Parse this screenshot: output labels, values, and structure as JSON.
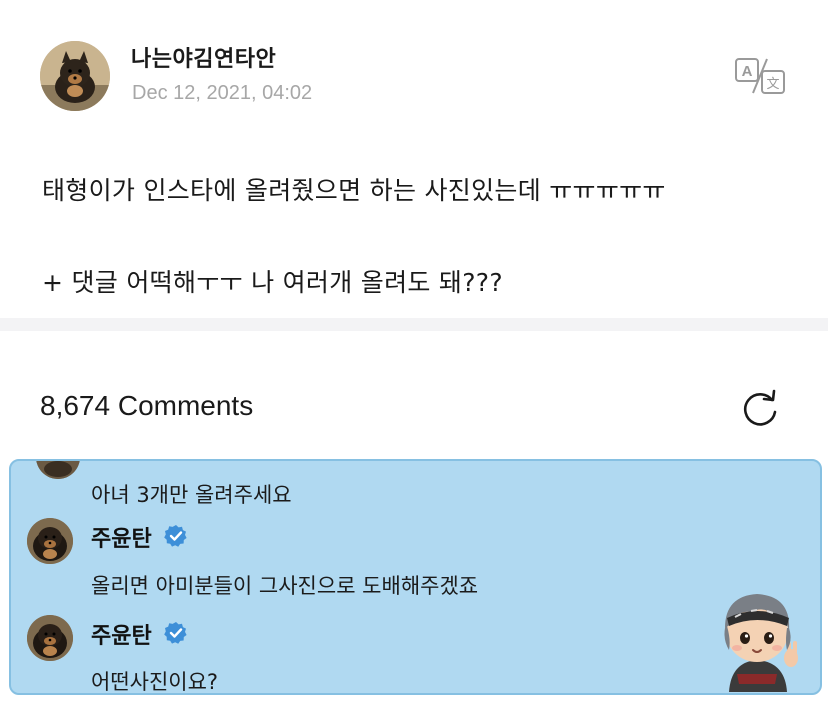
{
  "post": {
    "author_name": "나는야김연타안",
    "timestamp": "Dec 12, 2021, 04:02",
    "line1": "태형이가 인스타에 올려줬으면 하는 사진있는데 ㅠㅠㅠㅠㅠ",
    "line2": "+ 댓글 어떡해ㅜㅜ 나 여러개 올려도 돼???"
  },
  "icons": {
    "author_avatar": "dog-avatar",
    "translate": "translate-icon",
    "refresh": "refresh-icon",
    "verified": "verified-badge-icon"
  },
  "comments_header": {
    "count_label": "8,674 Comments"
  },
  "comments": {
    "partial_text": "아녀 3개만 올려주세요",
    "items": [
      {
        "name": "주윤탄",
        "text": "올리면 아미분들이 그사진으로 도배해주겠죠"
      },
      {
        "name": "주윤탄",
        "text": "어떤사진이요?"
      }
    ]
  },
  "colors": {
    "panel_bg": "#b0d9f1",
    "panel_border": "#86c0e2",
    "verified_blue": "#3d8fd8",
    "timestamp_gray": "#a7a7a7"
  }
}
